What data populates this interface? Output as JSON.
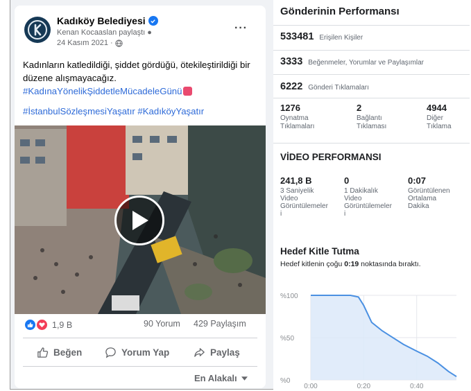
{
  "post": {
    "page_name": "Kadıköy Belediyesi",
    "shared_by": "Kenan Kocaaslan paylaştı",
    "date": "24 Kasım 2021 ·",
    "more": "···",
    "text": "Kadınların katledildiği, şiddet gördüğü, ötekileştirildiği bir düzene alışmayacağız.",
    "hashtag1": "#KadınaYönelikŞiddetleMücadeleGünü",
    "hashtag2": "#İstanbulSözleşmesiYaşatır #KadıköyYaşatır",
    "reactions_count": "1,9 B",
    "comments": "90 Yorum",
    "shares": "429 Paylaşım",
    "like_label": "Beğen",
    "comment_label": "Yorum Yap",
    "share_label": "Paylaş",
    "sort_label": "En Alakalı"
  },
  "performance": {
    "title": "Gönderinin Performansı",
    "reach": {
      "value": "533481",
      "label": "Erişilen Kişiler"
    },
    "engagements": {
      "value": "3333",
      "label": "Beğenmeler, Yorumlar ve Paylaşımlar"
    },
    "clicks": {
      "value": "6222",
      "label": "Gönderi Tıklamaları"
    },
    "breakdown": [
      {
        "value": "1276",
        "label1": "Oynatma",
        "label2": "Tıklamaları"
      },
      {
        "value": "2",
        "label1": "Bağlantı",
        "label2": "Tıklaması"
      },
      {
        "value": "4944",
        "label1": "Diğer",
        "label2": "Tıklama"
      }
    ]
  },
  "video": {
    "title": "VİDEO PERFORMANSI",
    "stats": [
      {
        "value": "241,8 B",
        "lines": [
          "3 Saniyelik",
          "Video",
          "Görüntülemeler",
          "i"
        ]
      },
      {
        "value": "0",
        "lines": [
          "1 Dakikalık",
          "Video",
          "Görüntülemeler",
          "i"
        ]
      },
      {
        "value": "0:07",
        "lines": [
          "Görüntülenen",
          "Ortalama",
          "Dakika",
          ""
        ]
      }
    ]
  },
  "retention": {
    "title": "Hedef Kitle Tutma",
    "sub_prefix": "Hedef kitlenin çoğu ",
    "sub_bold": "0:19",
    "sub_suffix": " noktasında bıraktı."
  },
  "colors": {
    "accent": "#1877f2",
    "line": "#4a90e2",
    "fill": "#dce9f9"
  },
  "chart_data": {
    "type": "area",
    "title": "Hedef Kitle Tutma",
    "x_ticks": [
      "0:00",
      "0:20",
      "0:40"
    ],
    "y_ticks": [
      "%100",
      "%50",
      "%0"
    ],
    "x_seconds": [
      0,
      10,
      15,
      18,
      20,
      23,
      27,
      30,
      35,
      40,
      44,
      48,
      52,
      54,
      55
    ],
    "y_percent": [
      100,
      100,
      100,
      98,
      88,
      68,
      58,
      52,
      42,
      34,
      28,
      20,
      10,
      6,
      4
    ],
    "xlim": [
      0,
      55
    ],
    "ylim": [
      0,
      100
    ],
    "grid": true
  }
}
